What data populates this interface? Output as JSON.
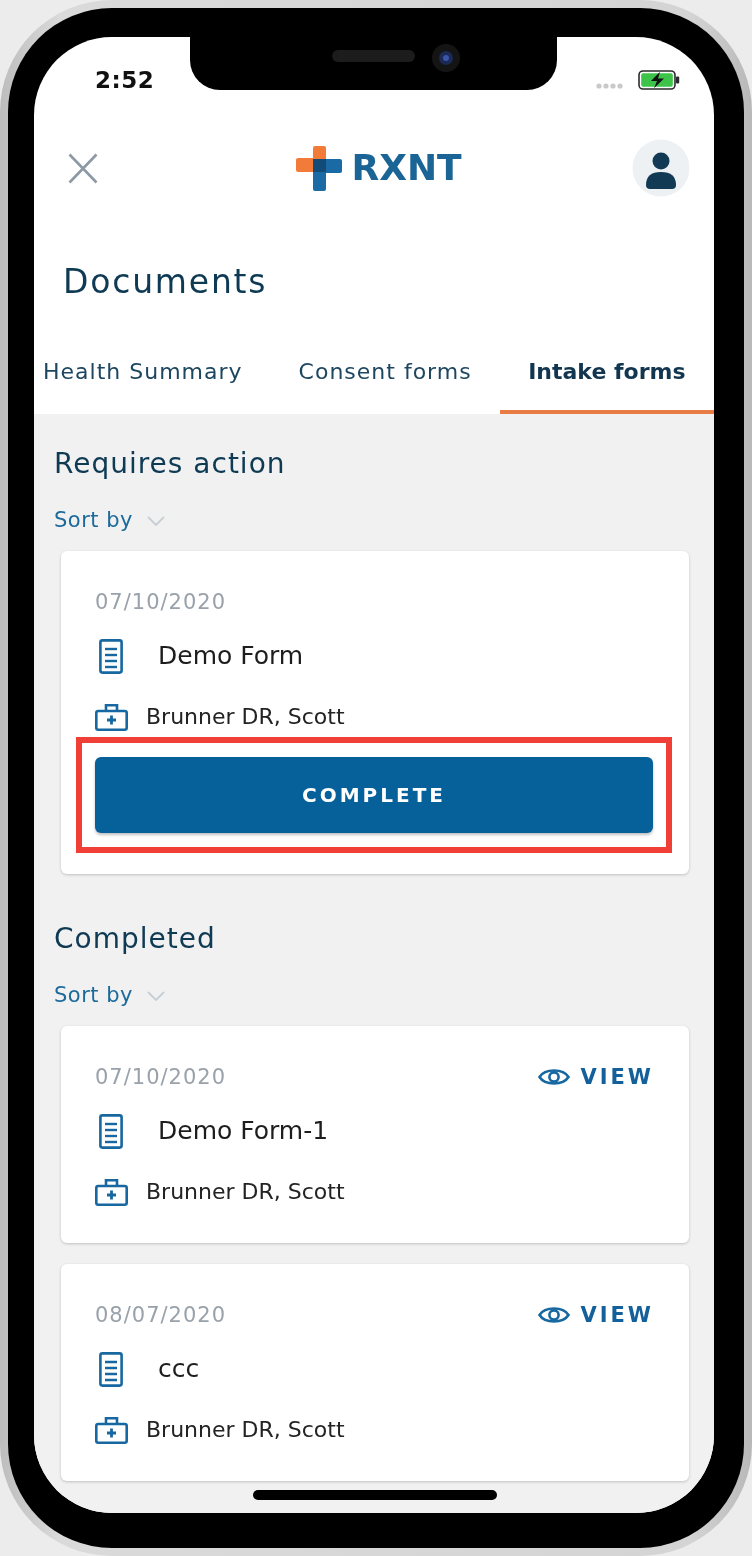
{
  "status_bar": {
    "time": "2:52"
  },
  "header": {
    "logo_text": "RXNT"
  },
  "page_title": "Documents",
  "tabs": [
    {
      "label": "Health Summary",
      "selected": false
    },
    {
      "label": "Consent forms",
      "selected": false
    },
    {
      "label": "Intake forms",
      "selected": true
    }
  ],
  "sections": [
    {
      "title": "Requires action",
      "sort_label": "Sort by",
      "cards": [
        {
          "date": "07/10/2020",
          "form_name": "Demo Form",
          "provider": "Brunner DR, Scott",
          "action": {
            "kind": "complete",
            "label": "COMPLETE",
            "highlighted": true
          }
        }
      ]
    },
    {
      "title": "Completed",
      "sort_label": "Sort by",
      "cards": [
        {
          "date": "07/10/2020",
          "form_name": "Demo Form-1",
          "provider": "Brunner DR, Scott",
          "action": {
            "kind": "view",
            "label": "VIEW",
            "highlighted": false
          }
        },
        {
          "date": "08/07/2020",
          "form_name": "ccc",
          "provider": "Brunner DR, Scott",
          "action": {
            "kind": "view",
            "label": "VIEW",
            "highlighted": false
          }
        }
      ]
    }
  ]
}
